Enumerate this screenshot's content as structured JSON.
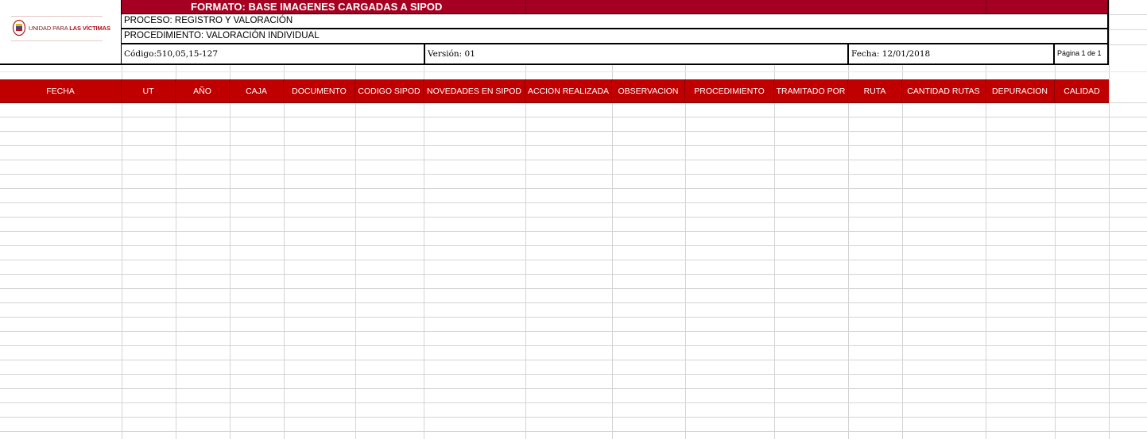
{
  "logo": {
    "text_prefix": "UNIDAD PARA ",
    "text_bold": "LAS VÍCTIMAS"
  },
  "header": {
    "title": "FORMATO: BASE IMAGENES CARGADAS A SIPOD",
    "proceso": "PROCESO:  REGISTRO Y VALORACIÓN",
    "procedimiento": "PROCEDIMIENTO: VALORACIÓN INDIVIDUAL",
    "codigo": "Código:510,05,15-127",
    "version": "Versión: 01",
    "fecha": "Fecha:  12/01/2018",
    "pagina": "Página 1 de 1"
  },
  "columns": [
    "FECHA",
    "UT",
    "AÑO",
    "CAJA",
    "DOCUMENTO",
    "CODIGO SIPOD",
    "NOVEDADES EN SIPOD",
    "ACCION REALIZADA",
    "OBSERVACION",
    "PROCEDIMIENTO",
    "TRAMITADO POR",
    "RUTA",
    "CANTIDAD RUTAS",
    "DEPURACION",
    "CALIDAD"
  ],
  "colors": {
    "title_bar": "#a50021",
    "header_row": "#c00000"
  }
}
